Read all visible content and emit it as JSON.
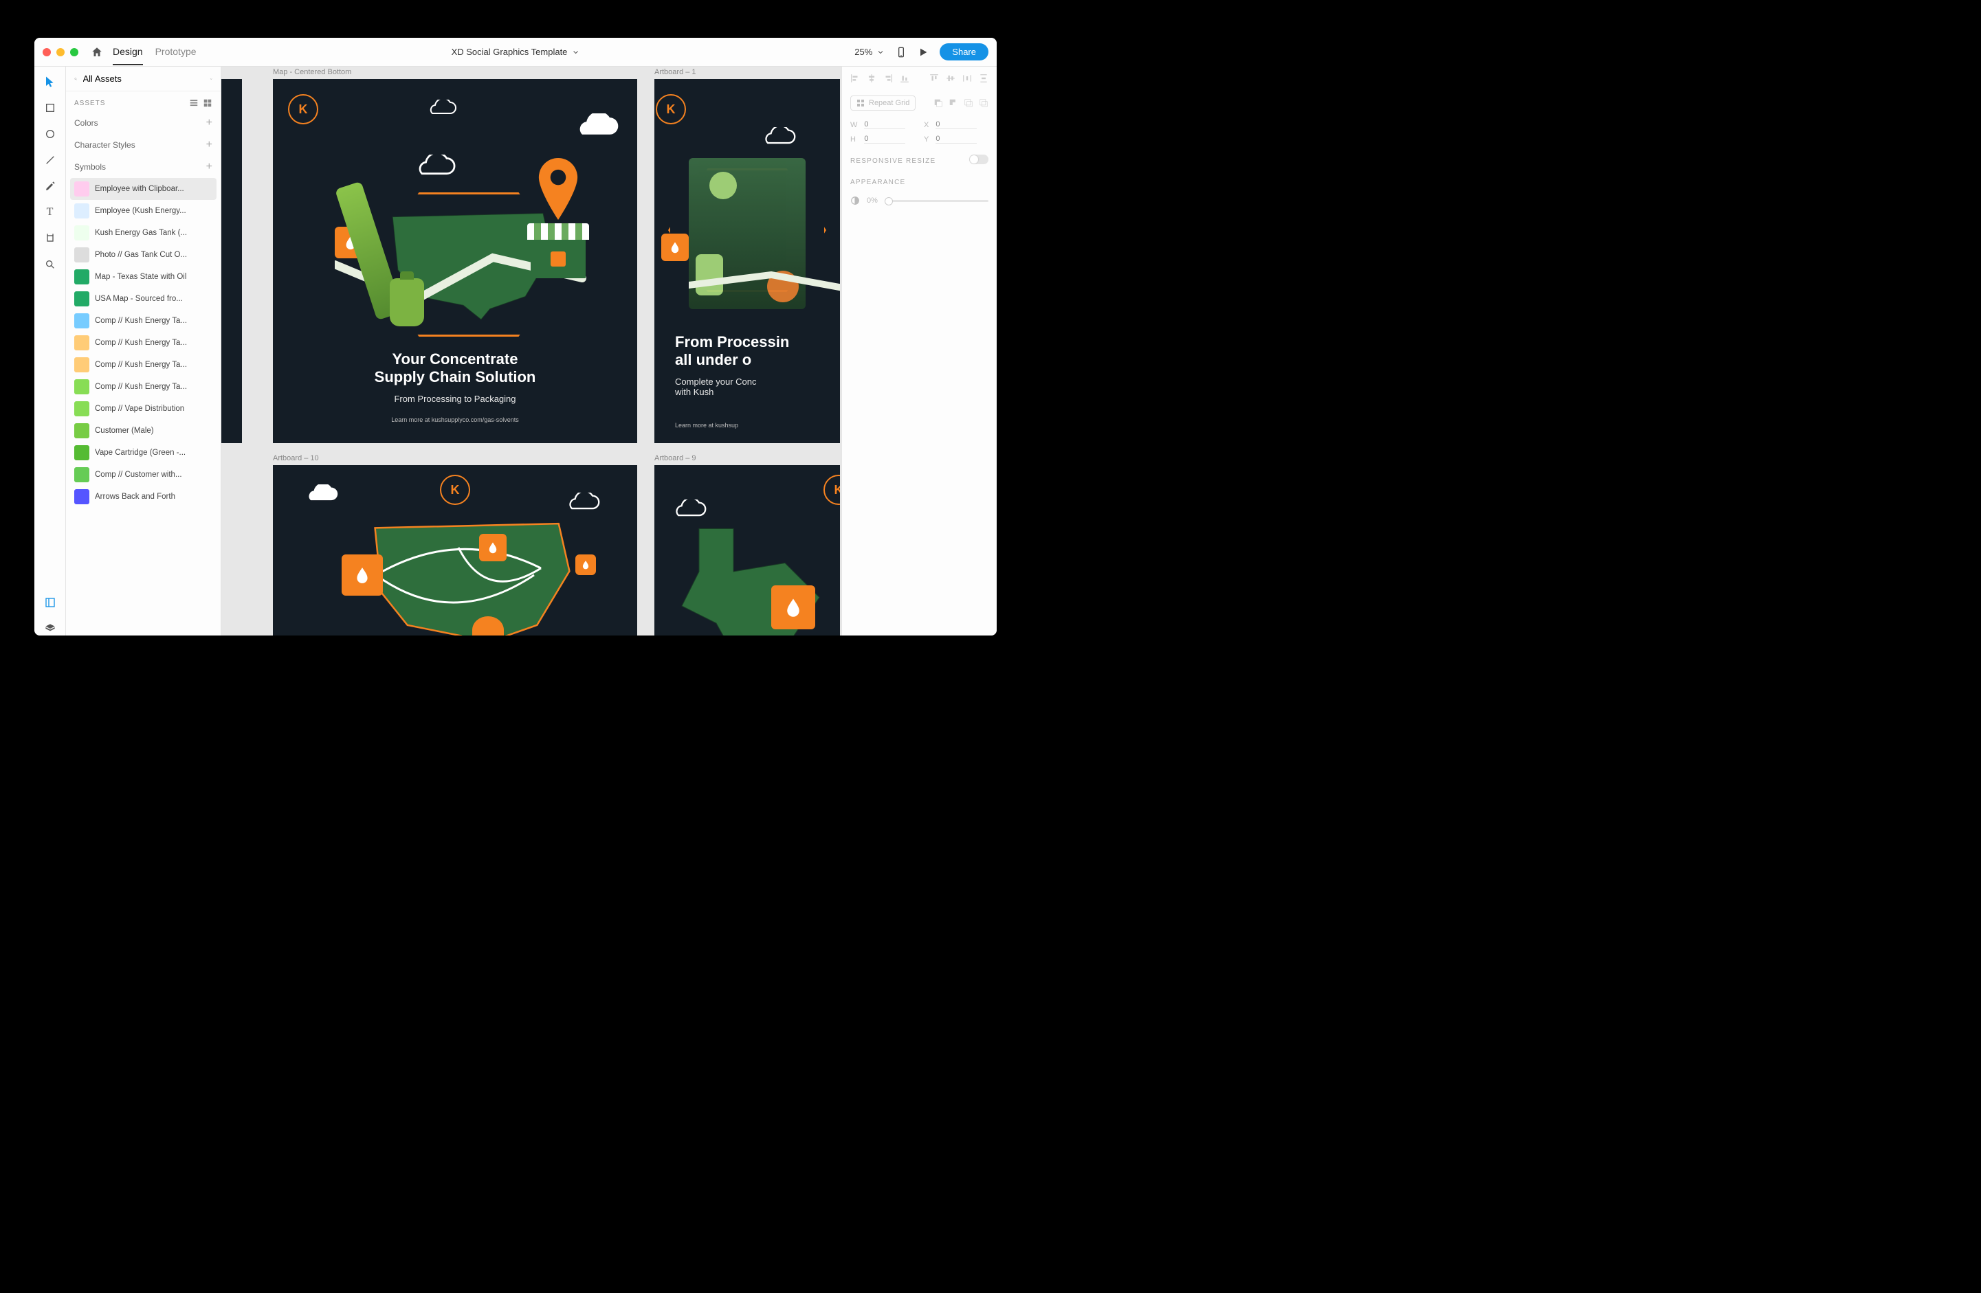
{
  "titlebar": {
    "tabs": {
      "design": "Design",
      "prototype": "Prototype"
    },
    "doc_title": "XD Social Graphics Template",
    "zoom": "25%",
    "share": "Share"
  },
  "assets": {
    "search_label": "All Assets",
    "section_title": "ASSETS",
    "colors_label": "Colors",
    "char_styles_label": "Character Styles",
    "symbols_label": "Symbols",
    "symbols_list": [
      {
        "label": "Employee with Clipboar..."
      },
      {
        "label": "Employee (Kush Energy..."
      },
      {
        "label": "Kush Energy Gas Tank (..."
      },
      {
        "label": "Photo // Gas Tank Cut O..."
      },
      {
        "label": "Map - Texas State with Oil"
      },
      {
        "label": "USA Map - Sourced fro..."
      },
      {
        "label": "Comp // Kush Energy Ta..."
      },
      {
        "label": "Comp // Kush Energy Ta..."
      },
      {
        "label": "Comp // Kush Energy Ta..."
      },
      {
        "label": "Comp // Kush Energy Ta..."
      },
      {
        "label": "Comp // Vape Distribution"
      },
      {
        "label": "Customer (Male)"
      },
      {
        "label": "Vape Cartridge (Green -..."
      },
      {
        "label": "Comp // Customer with..."
      },
      {
        "label": "Arrows Back and Forth"
      }
    ]
  },
  "canvas": {
    "artboards": [
      {
        "name": "Map - Centered Bottom"
      },
      {
        "name": "Artboard – 1"
      },
      {
        "name": "Artboard – 10"
      },
      {
        "name": "Artboard – 9"
      }
    ],
    "ab1": {
      "headline_l1": "Your Concentrate",
      "headline_l2": "Supply Chain Solution",
      "sub": "From Processing to Packaging",
      "url": "Learn more at kushsupplyco.com/gas-solvents"
    },
    "ab2": {
      "headline_l1": "From Processin",
      "headline_l2": "all under o",
      "sub": "Complete your Conc",
      "sub2": "with Kush",
      "url": "Learn more at kushsup"
    }
  },
  "inspector": {
    "repeat_label": "Repeat Grid",
    "w_label": "W",
    "w_val": "0",
    "h_label": "H",
    "h_val": "0",
    "x_label": "X",
    "x_val": "0",
    "y_label": "Y",
    "y_val": "0",
    "responsive": "RESPONSIVE RESIZE",
    "appearance": "APPEARANCE",
    "opacity": "0%"
  }
}
